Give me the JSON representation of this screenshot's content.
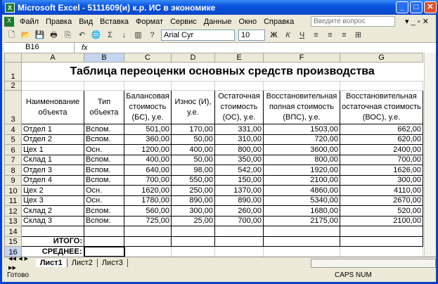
{
  "window": {
    "title": "Microsoft Excel - 5111609(и) к.р. ИС в экономике"
  },
  "menu": [
    "Файл",
    "Правка",
    "Вид",
    "Вставка",
    "Формат",
    "Сервис",
    "Данные",
    "Окно",
    "Справка"
  ],
  "ask_placeholder": "Введите вопрос",
  "toolbar": {
    "font": "Arial Cyr",
    "size": "10",
    "bold": "Ж",
    "italic": "К",
    "underline": "Ч"
  },
  "formula": {
    "cell": "B16",
    "fx": "fx",
    "value": ""
  },
  "columns": [
    "A",
    "B",
    "C",
    "D",
    "E",
    "F",
    "G"
  ],
  "sheet": {
    "title": "Таблица переоценки основных средств производства",
    "headers": [
      "Наименование объекта",
      "Тип объекта",
      "Балансовая стоимость (БС), у.е.",
      "Износ (И), у.е.",
      "Остаточная стоимость (ОС), у.е.",
      "Восстановительная полная стоимость (ВПС), у.е.",
      "Восстановительная остаточная стоимость (ВОС), у.е."
    ],
    "rows": [
      [
        "Отдел 1",
        "Вспом.",
        "501,00",
        "170,00",
        "331,00",
        "1503,00",
        "662,00"
      ],
      [
        "Отдел 2",
        "Вспом.",
        "360,00",
        "50,00",
        "310,00",
        "720,00",
        "620,00"
      ],
      [
        "Цех 1",
        "Осн.",
        "1200,00",
        "400,00",
        "800,00",
        "3600,00",
        "2400,00"
      ],
      [
        "Склад 1",
        "Вспом.",
        "400,00",
        "50,00",
        "350,00",
        "800,00",
        "700,00"
      ],
      [
        "Отдел 3",
        "Вспом.",
        "640,00",
        "98,00",
        "542,00",
        "1920,00",
        "1626,00"
      ],
      [
        "Отдел 4",
        "Вспом.",
        "700,00",
        "550,00",
        "150,00",
        "2100,00",
        "300,00"
      ],
      [
        "Цех 2",
        "Осн.",
        "1620,00",
        "250,00",
        "1370,00",
        "4860,00",
        "4110,00"
      ],
      [
        "Цех 3",
        "Осн.",
        "1780,00",
        "890,00",
        "890,00",
        "5340,00",
        "2670,00"
      ],
      [
        "Склад 2",
        "Вспом.",
        "560,00",
        "300,00",
        "260,00",
        "1680,00",
        "520,00"
      ],
      [
        "Склад 3",
        "Вспом.",
        "725,00",
        "25,00",
        "700,00",
        "2175,00",
        "2100,00"
      ]
    ],
    "total_label": "ИТОГО:",
    "avg_label": "СРЕДНЕЕ:"
  },
  "tabs": [
    "Лист1",
    "Лист2",
    "Лист3"
  ],
  "status": {
    "left": "Готово",
    "right": "CAPS NUM"
  }
}
